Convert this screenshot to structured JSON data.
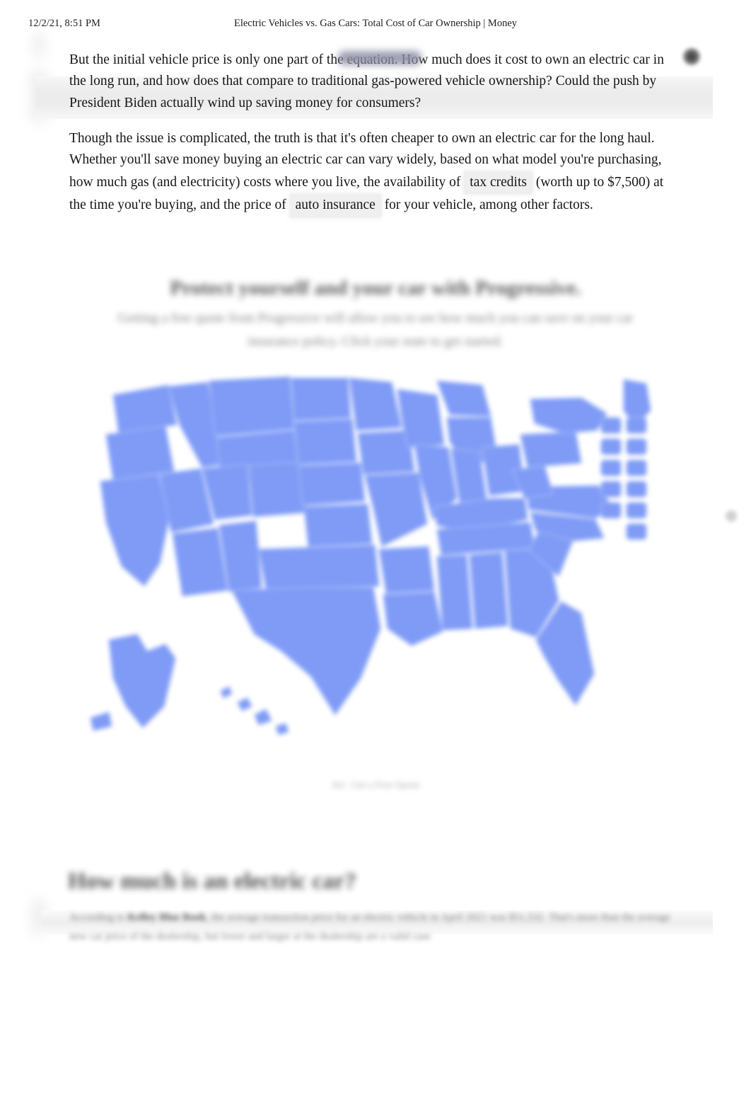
{
  "print_header": {
    "date": "12/2/21, 8:51 PM",
    "title": "Electric Vehicles vs. Gas Cars: Total Cost of Car Ownership | Money"
  },
  "article": {
    "paragraph_1_part_a": "But the initial vehicle price is only one part of the equation. How much does it cost to own an electric car in the long run, and how does that compare to traditional gas-powered vehicle ownership? Could the push by President Biden actually wind up saving money for consumers?",
    "paragraph_2_part_a": "Though the issue is complicated, the truth is that it's often cheaper to own an electric car for the long haul. Whether you'll save money buying an electric car can vary widely, based on what model you're purchasing, how much gas (and electricity) costs where you live, the availability of",
    "link_tax_credits": "tax credits",
    "paragraph_2_part_b": "(worth up to $7,500) at the time you're buying, and the price of",
    "link_auto_insurance": "auto insurance",
    "paragraph_2_part_c": "for your vehicle, among other factors.",
    "section_heading": "How much is an electric car?",
    "closing_paragraph_lead": "According to",
    "closing_paragraph_bold": "Kelley Blue Book",
    "closing_paragraph_rest": ", the average transaction price for an electric vehicle in April 2021 was $51,532. That's more than the average new car price of the dealership, but lower and larger at the dealership are a valid case"
  },
  "advertisement": {
    "headline": "Protect yourself and your car with Progressive.",
    "subheadline": "Getting a free quote from Progressive will allow you to see how much you can save on your car insurance policy. Click your state to get started.",
    "caption": "Ad - Get a Free Quote",
    "map_color": "#7f9bf6",
    "map_border_color": "#a9bdf9",
    "close_icon": "close-icon",
    "info_icon": "info-icon"
  },
  "map_data": {
    "region": "United States",
    "small_state_boxes": [
      "VT",
      "NH",
      "MA",
      "RI",
      "CT",
      "NJ",
      "DE",
      "MD",
      "DC"
    ]
  }
}
